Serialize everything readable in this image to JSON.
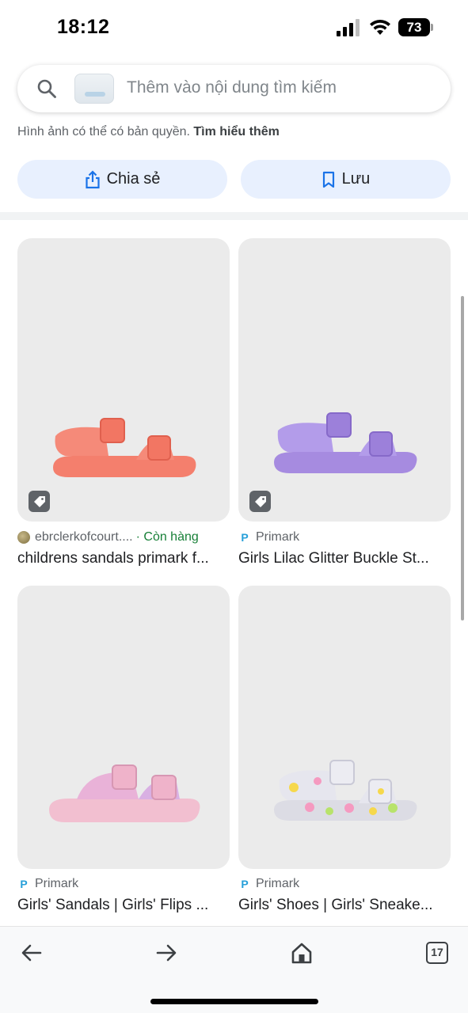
{
  "status_bar": {
    "time": "18:12",
    "battery": "73"
  },
  "search": {
    "placeholder": "Thêm vào nội dung tìm kiếm"
  },
  "copyright": {
    "text": "Hình ảnh có thể có bản quyền.",
    "link": "Tìm hiểu thêm"
  },
  "actions": {
    "share_label": "Chia sẻ",
    "save_label": "Lưu"
  },
  "results": [
    {
      "source": "ebrclerkofcourt....",
      "stock": "· Còn hàng",
      "title": "childrens sandals primark f...",
      "shoe_color": "#f47f6d"
    },
    {
      "source": "Primark",
      "stock": "",
      "title": "Girls Lilac Glitter Buckle St...",
      "shoe_color": "#a68be0"
    },
    {
      "source": "Primark",
      "stock": "",
      "title": "Girls' Sandals | Girls' Flips ...",
      "shoe_color": "#f2bfd0"
    },
    {
      "source": "Primark",
      "stock": "",
      "title": "Girls' Shoes | Girls' Sneake...",
      "shoe_color": "#dcdce4"
    }
  ],
  "bottom_nav": {
    "tab_count": "17"
  },
  "colors": {
    "accent": "#1a73e8",
    "button_bg": "#e8f0fe",
    "stock_green": "#188038"
  }
}
